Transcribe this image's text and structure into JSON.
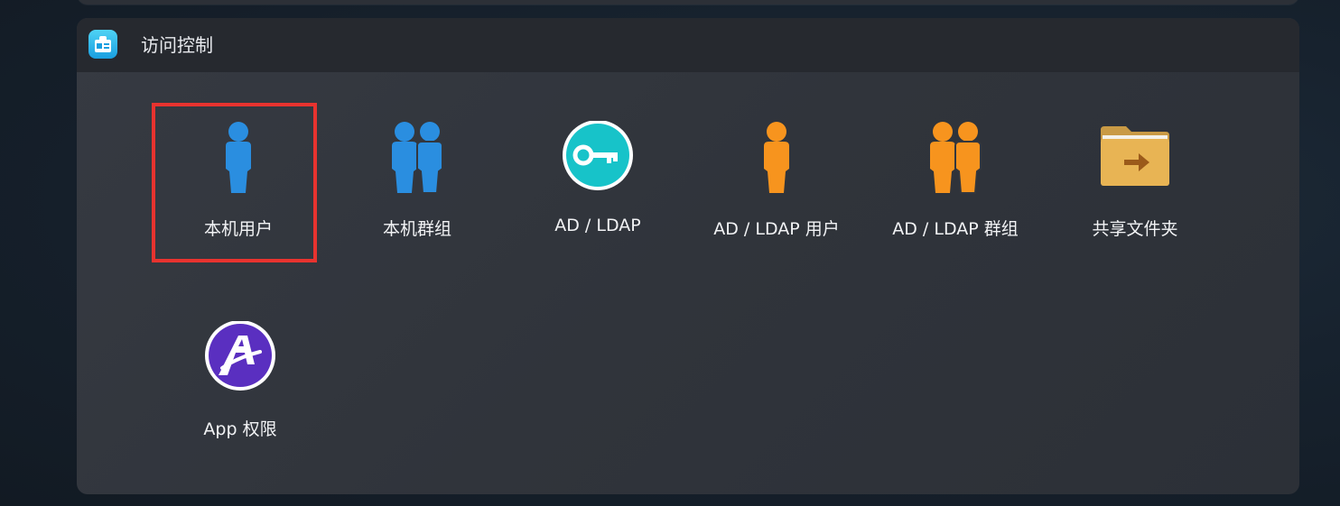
{
  "panel": {
    "title": "访问控制",
    "header_icon": "access-control-app-icon"
  },
  "items": [
    {
      "label": "本机用户",
      "icon": "local-user-icon",
      "color": "#2a8ee0"
    },
    {
      "label": "本机群组",
      "icon": "local-group-icon",
      "color": "#2a8ee0"
    },
    {
      "label": "AD / LDAP",
      "icon": "key-icon",
      "color": "#17c3c9"
    },
    {
      "label": "AD / LDAP 用户",
      "icon": "ldap-user-icon",
      "color": "#f7941e"
    },
    {
      "label": "AD / LDAP 群组",
      "icon": "ldap-group-icon",
      "color": "#f7941e"
    },
    {
      "label": "共享文件夹",
      "icon": "shared-folder-icon",
      "color": "#e8b454"
    },
    {
      "label": "App 权限",
      "icon": "app-permission-icon",
      "color": "#5a2fc0"
    }
  ],
  "selection": {
    "highlight_color": "#e8332f",
    "selected_item": "本机用户"
  }
}
